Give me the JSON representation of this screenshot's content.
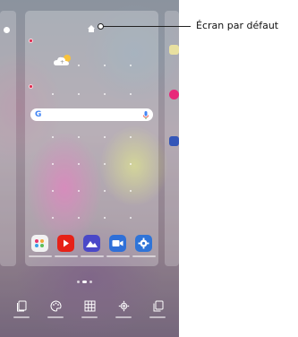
{
  "callout": {
    "label": "Écran par défaut"
  },
  "search": {
    "logo": "G"
  },
  "home_screens": [
    "left",
    "default",
    "right"
  ],
  "dock_apps": [
    {
      "icon": "gallery-icon",
      "color": "#f2f2f2"
    },
    {
      "icon": "youtube-icon",
      "color": "#e62117"
    },
    {
      "icon": "mountain-photo-icon",
      "color": "#4a48c8"
    },
    {
      "icon": "video-camera-icon",
      "color": "#2f6fd8"
    },
    {
      "icon": "gear-icon",
      "color": "#2f74d8"
    }
  ],
  "bottom_bar": [
    {
      "icon": "wallpaper-icon"
    },
    {
      "icon": "palette-icon"
    },
    {
      "icon": "widgets-grid-icon"
    },
    {
      "icon": "settings-icon"
    },
    {
      "icon": "copy-page-icon"
    }
  ],
  "colors": {
    "accent": "#e0244a",
    "callout_line": "#222222"
  }
}
